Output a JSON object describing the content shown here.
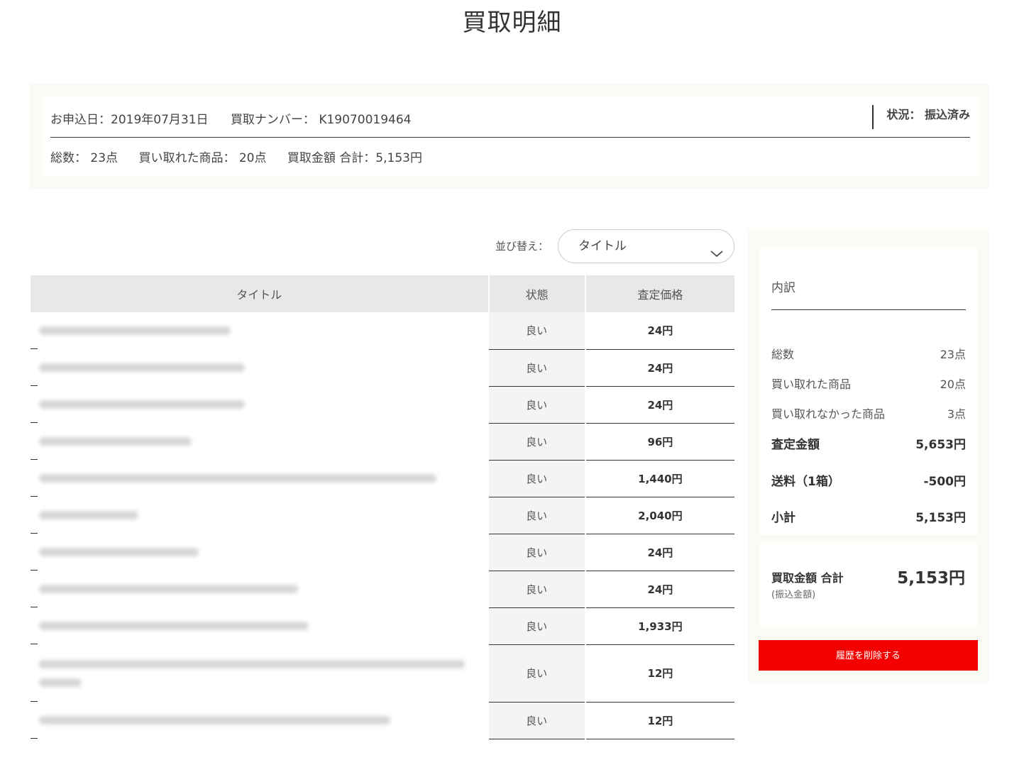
{
  "page": {
    "title": "買取明細"
  },
  "summary": {
    "apply_date": "お申込日：2019年07月31日",
    "purchase_number": "買取ナンバー： K19070019464",
    "status": "状況： 振込済み",
    "total_count": "総数： 23点",
    "bought_items": "買い取れた商品： 20点",
    "total_amount": "買取金額 合計：5,153円"
  },
  "sort": {
    "label": "並び替え：",
    "selected": "タイトル",
    "icon": "chevron-down-icon"
  },
  "table": {
    "headers": [
      "タイトル",
      "状態",
      "査定価格"
    ],
    "rows": [
      {
        "condition": "良い",
        "price": "24円"
      },
      {
        "condition": "良い",
        "price": "24円"
      },
      {
        "condition": "良い",
        "price": "24円"
      },
      {
        "condition": "良い",
        "price": "96円"
      },
      {
        "condition": "良い",
        "price": "1,440円"
      },
      {
        "condition": "良い",
        "price": "2,040円"
      },
      {
        "condition": "良い",
        "price": "24円"
      },
      {
        "condition": "良い",
        "price": "24円"
      },
      {
        "condition": "良い",
        "price": "1,933円"
      },
      {
        "condition": "良い",
        "price": "12円"
      },
      {
        "condition": "良い",
        "price": "12円"
      }
    ]
  },
  "breakdown": {
    "title": "内訳",
    "rows": [
      {
        "label": "総数",
        "value": "23点"
      },
      {
        "label": "買い取れた商品",
        "value": "20点"
      },
      {
        "label": "買い取れなかった商品",
        "value": "3点"
      },
      {
        "label": "査定金額",
        "value": "5,653円"
      },
      {
        "label": "送料（1箱）",
        "value": "-500円"
      },
      {
        "label": "小計",
        "value": "5,153円"
      }
    ]
  },
  "total": {
    "label": "買取金額 合計",
    "sublabel": "(振込金額)",
    "value": "5,153円"
  },
  "actions": {
    "delete_label": "履歴を削除する"
  },
  "colors": {
    "accent_red": "#f40000",
    "panel_bg": "#fbfbf5"
  }
}
